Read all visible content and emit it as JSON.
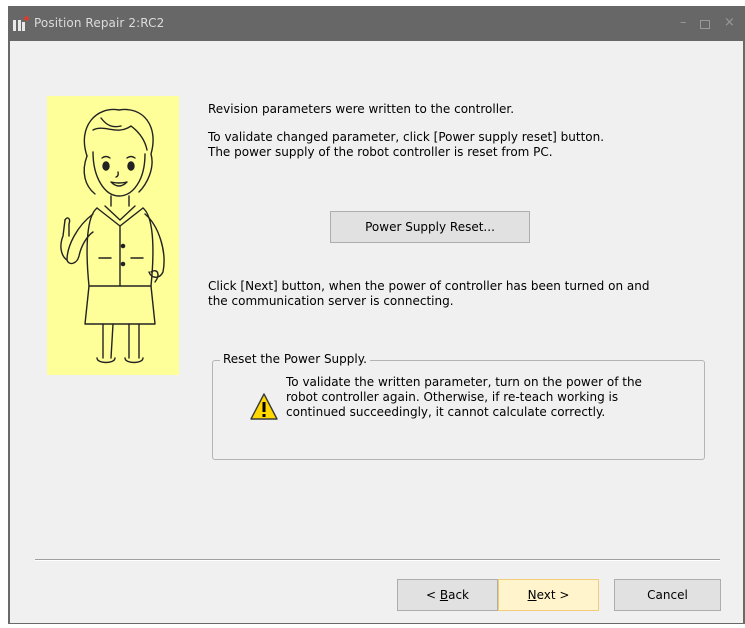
{
  "window": {
    "title": "Position Repair 2:RC2",
    "min_glyph": "–",
    "close_glyph": "×"
  },
  "content": {
    "line1": "Revision parameters were written to the controller.",
    "line2": "To validate changed parameter, click [Power supply reset] button.",
    "line3": "The power supply of the robot controller is reset from PC.",
    "reset_button": "Power Supply Reset...",
    "next_info_1": "Click [Next] button, when the power of controller has been turned on and",
    "next_info_2": "the communication server is connecting."
  },
  "group": {
    "label": "Reset the Power Supply.",
    "warning_1": "To validate the written parameter, turn on the power of the",
    "warning_2": "robot controller again. Otherwise, if re-teach working is",
    "warning_3": "continued succeedingly, it cannot calculate correctly."
  },
  "footer": {
    "back_prefix": "< ",
    "back_hotkey": "B",
    "back_rest": "ack",
    "next_hotkey": "N",
    "next_rest": "ext >",
    "cancel": "Cancel"
  },
  "icons": {
    "app": "robot-app-icon",
    "character": "character-illustration",
    "warning": "warning-icon"
  },
  "colors": {
    "titlebar": "#676767",
    "client": "#f0f0f0",
    "character_bg": "#ffff99",
    "next_highlight": "#fff4cc"
  }
}
